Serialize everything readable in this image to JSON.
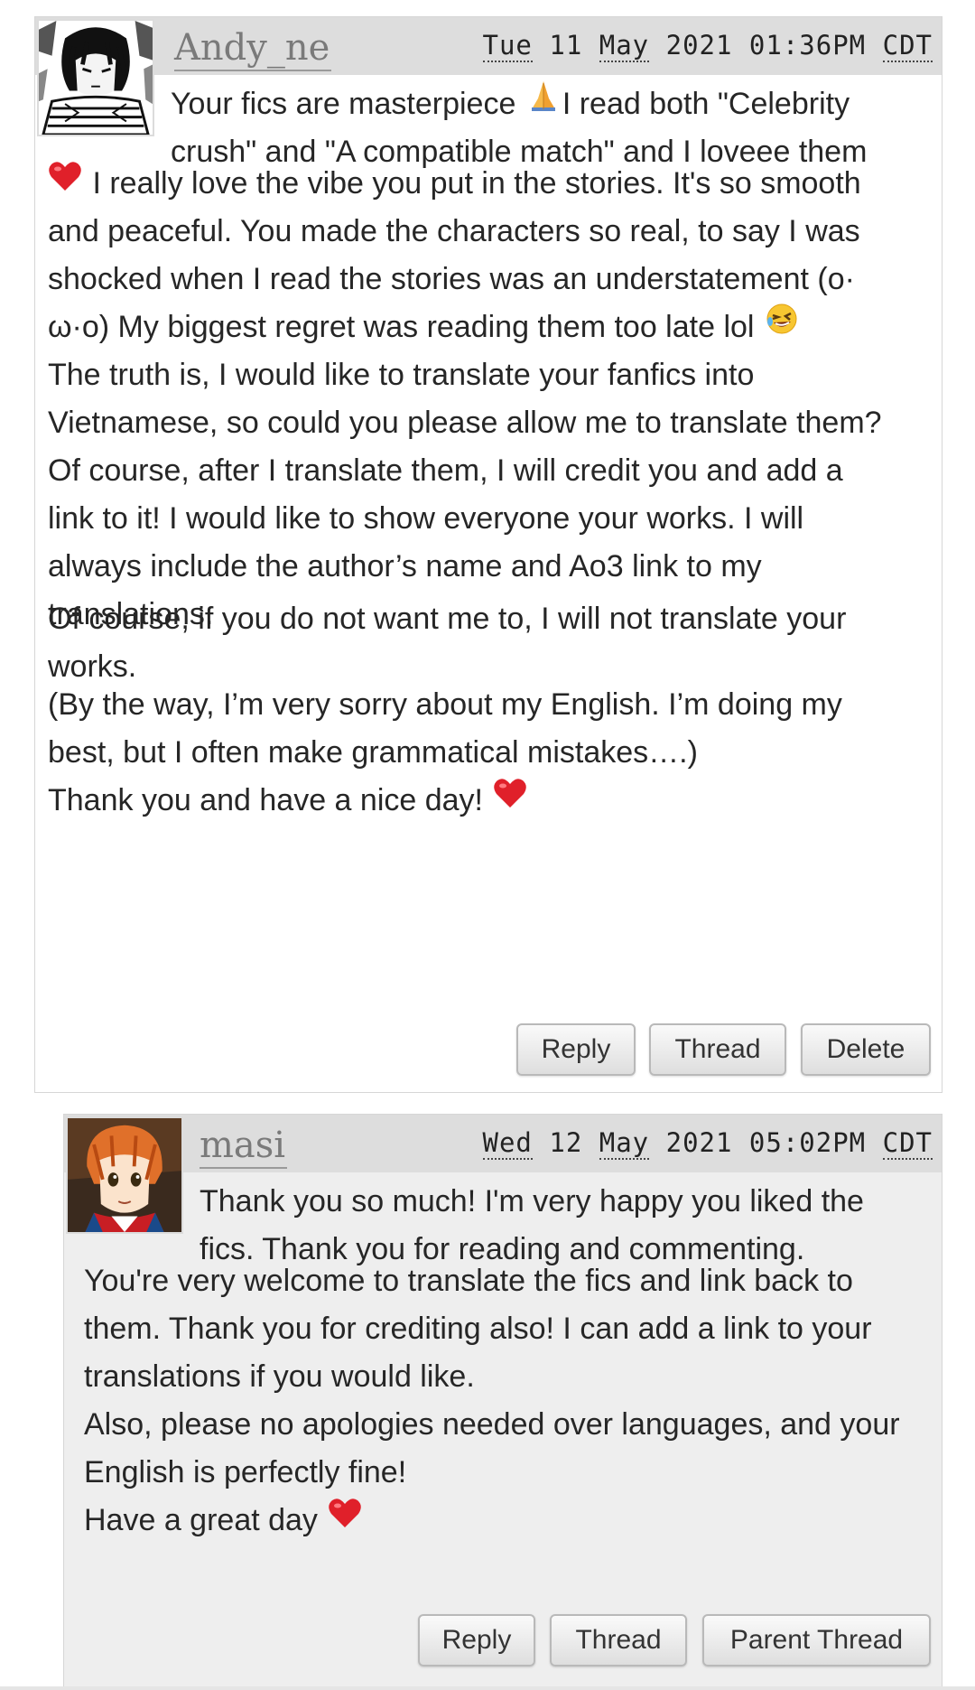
{
  "comments": [
    {
      "author": "Andy_ne",
      "date": {
        "weekday": "Tue",
        "day": "11",
        "month": "May",
        "year": "2021",
        "time": "01:36PM",
        "tz": "CDT"
      },
      "avatar_icon": "manga-character-avatar",
      "lines": [
        "Your fics are masterpiece ",
        "I read both \"Celebrity",
        "crush\" and \"A compatible match\" and I loveee them",
        " I really love the vibe you put in the stories. It's so smooth",
        "and peaceful. You made the characters so real, to say I was",
        "shocked when I read the stories was an understatement (o·",
        "ω·o) My biggest regret was reading them too late lol ",
        "The truth is, I would like to translate your fanfics into",
        "Vietnamese, so could you please allow me to translate them?",
        "Of course, after I translate them, I will credit you and add a",
        "link to it! I would like to show everyone your works. I will",
        "always include the author’s name and Ao3 link to my",
        "translations.",
        "Of course, if you do not want me to, I will not translate your",
        "works.",
        "(By the way, I’m very sorry about my English. I’m doing my",
        "best, but I often make grammatical mistakes….)",
        "Thank you and have a nice day! "
      ],
      "emoji_icons": [
        "folded-hands-emoji",
        "red-heart-emoji",
        "rolling-laughing-emoji",
        "red-heart-emoji"
      ],
      "buttons": [
        "Reply",
        "Thread",
        "Delete"
      ]
    },
    {
      "author": "masi",
      "date": {
        "weekday": "Wed",
        "day": "12",
        "month": "May",
        "year": "2021",
        "time": "05:02PM",
        "tz": "CDT"
      },
      "avatar_icon": "anime-character-avatar",
      "lines": [
        "Thank you so much! I'm very happy you liked the",
        "fics. Thank you for reading and commenting.",
        "You're very welcome to translate the fics and link back to",
        "them. Thank you for crediting also! I can add a link to your",
        "translations if you would like.",
        "Also, please no apologies needed over languages, and your",
        "English is perfectly fine!",
        "Have a great day "
      ],
      "emoji_icons": [
        "red-heart-emoji"
      ],
      "buttons": [
        "Reply",
        "Thread",
        "Parent Thread"
      ]
    }
  ],
  "colors": {
    "header_bar": "#dddddd",
    "reply_background": "#eeeeee",
    "heart": "#e0202a"
  }
}
